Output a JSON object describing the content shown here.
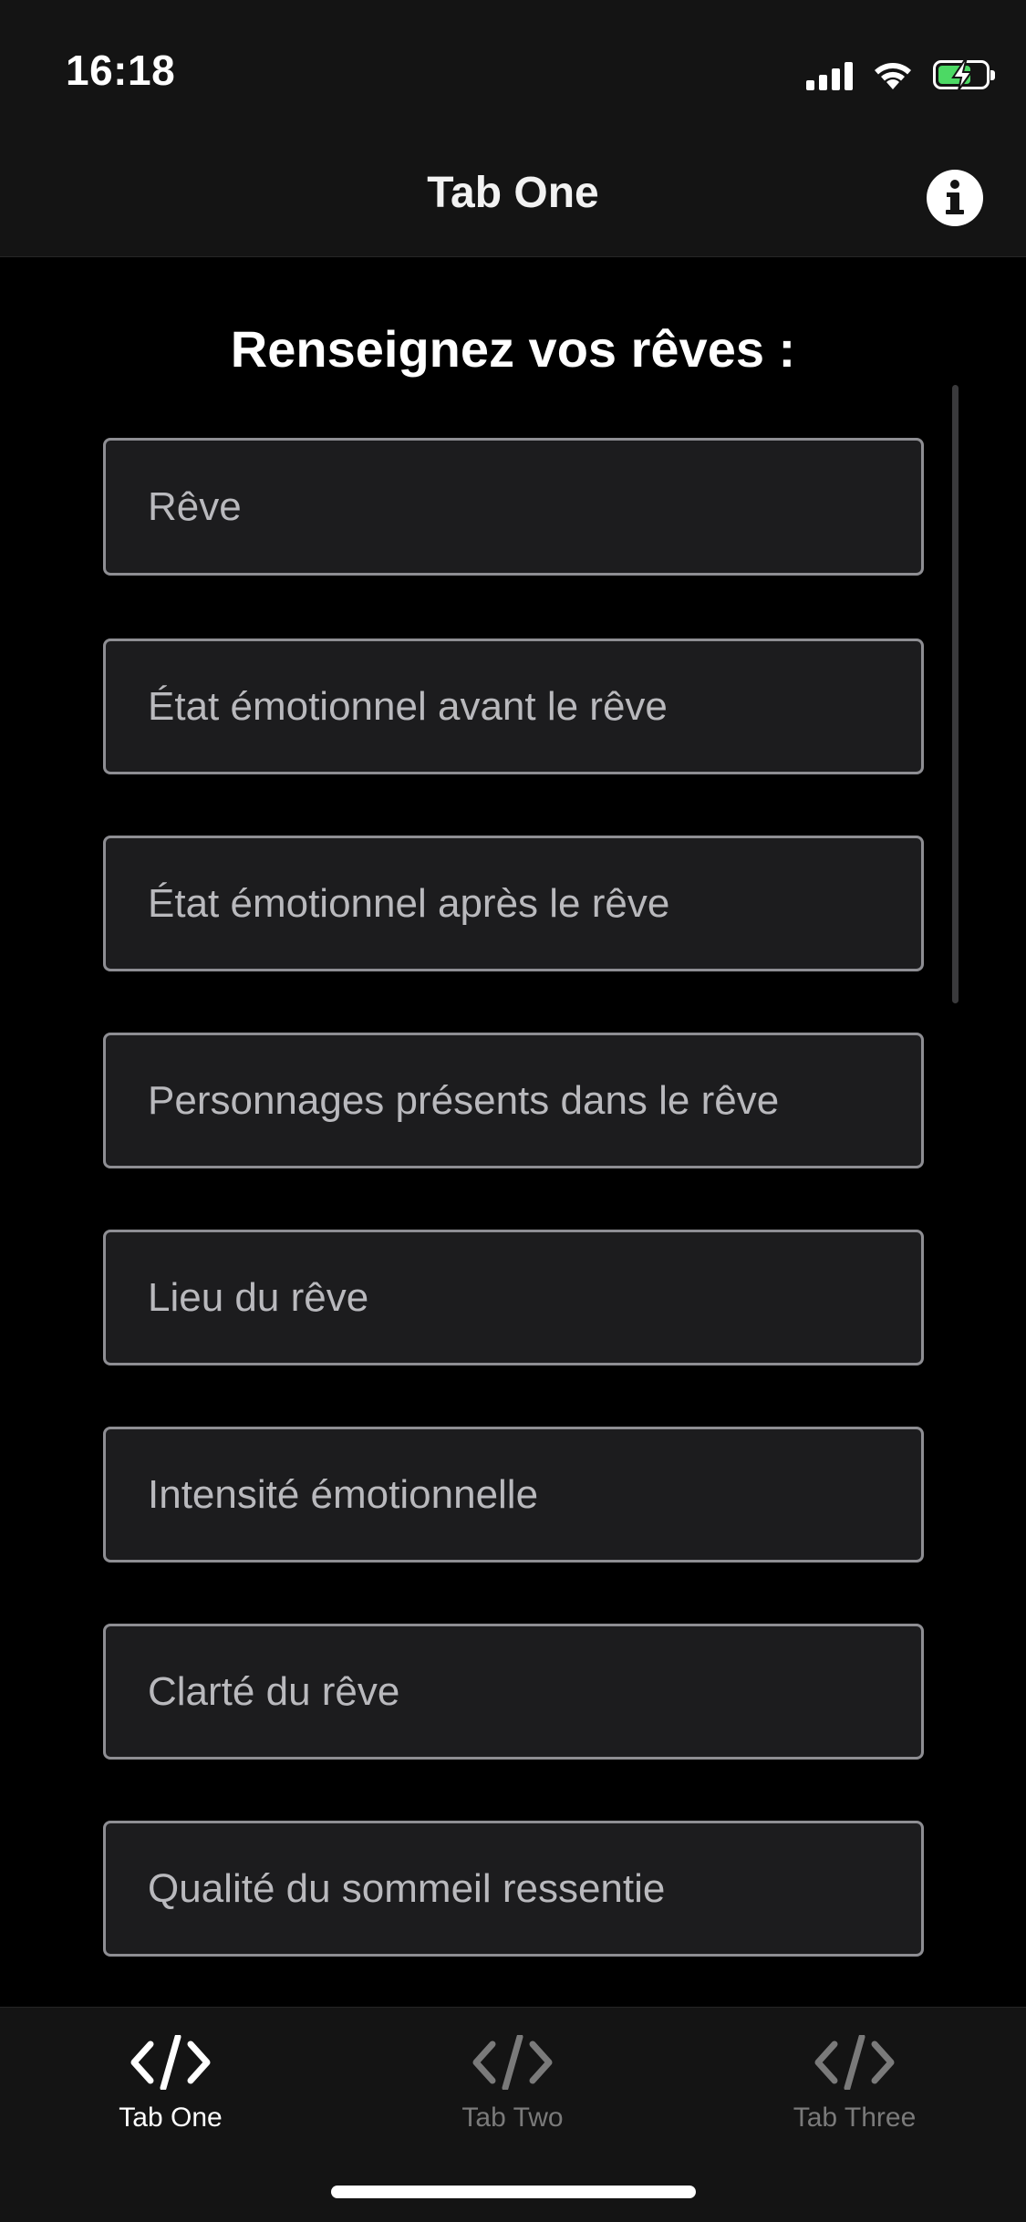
{
  "status_bar": {
    "time": "16:18",
    "signal_icon": "signal-bars-icon",
    "wifi_icon": "wifi-icon",
    "battery_icon": "battery-charging-icon",
    "battery_level": 0.7,
    "battery_color": "#4cd964"
  },
  "header": {
    "title": "Tab One",
    "info_icon": "info-circle-icon"
  },
  "form": {
    "title": "Renseignez vos rêves :",
    "fields": [
      {
        "placeholder": "Rêve"
      },
      {
        "placeholder": "État émotionnel avant le rêve"
      },
      {
        "placeholder": "État émotionnel après le rêve"
      },
      {
        "placeholder": "Personnages présents dans le rêve"
      },
      {
        "placeholder": "Lieu du rêve"
      },
      {
        "placeholder": "Intensité émotionnelle"
      },
      {
        "placeholder": "Clarté du rêve"
      },
      {
        "placeholder": "Qualité du sommeil ressentie"
      }
    ]
  },
  "tab_bar": {
    "active_index": 0,
    "tabs": [
      {
        "label": "Tab One",
        "icon": "code-icon"
      },
      {
        "label": "Tab Two",
        "icon": "code-icon"
      },
      {
        "label": "Tab Three",
        "icon": "code-icon"
      }
    ]
  },
  "colors": {
    "background": "#000000",
    "bar_background": "#141414",
    "field_background": "#1c1c1e",
    "field_border": "#8e8e93",
    "active_tab": "#ffffff",
    "inactive_tab": "#7a7a7a"
  }
}
